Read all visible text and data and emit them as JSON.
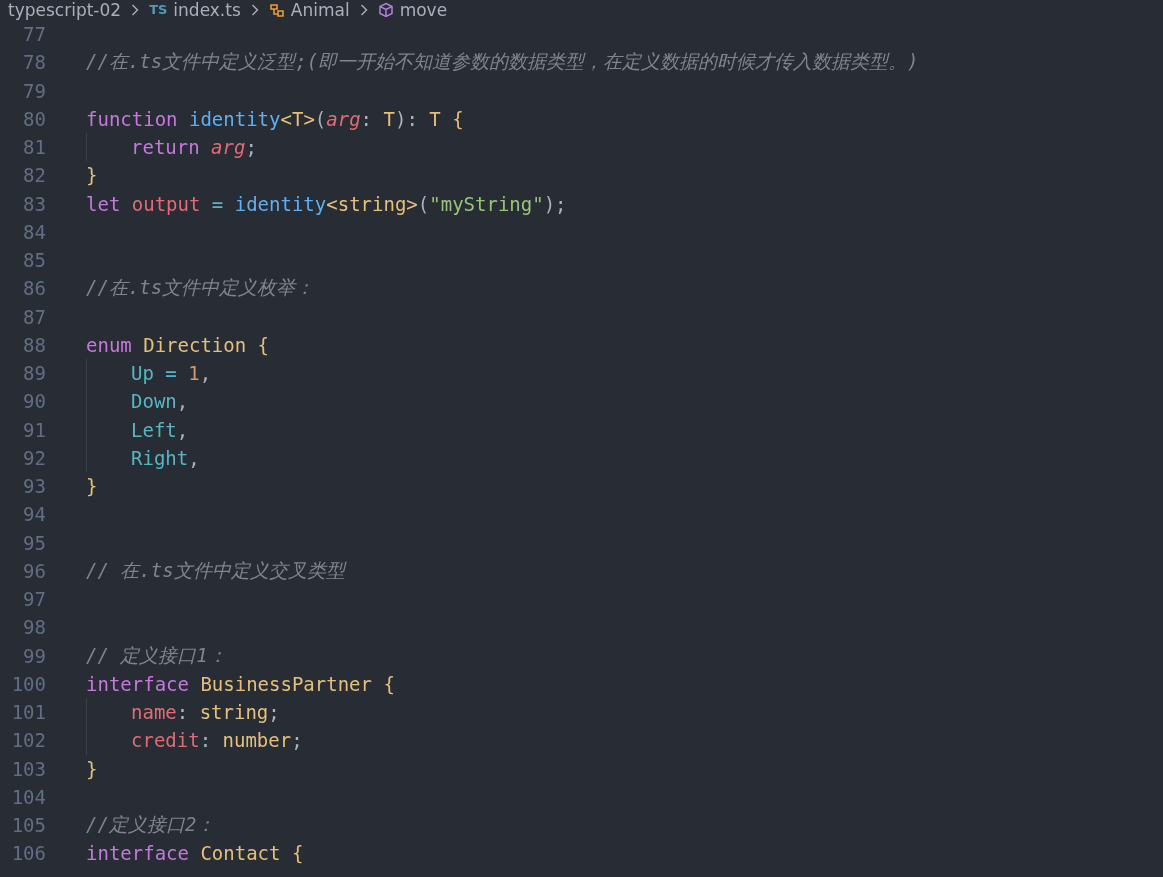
{
  "breadcrumb": [
    {
      "kind": "folder",
      "label": "typescript-02"
    },
    {
      "kind": "file",
      "badge": "TS",
      "label": "index.ts"
    },
    {
      "kind": "class",
      "label": "Animal"
    },
    {
      "kind": "method",
      "label": "move"
    }
  ],
  "lines": [
    {
      "number": "77"
    },
    {
      "number": "78",
      "tokens": [
        {
          "kind": "comment",
          "text": "//在.ts文件中定义泛型;(即一开始不知道参数的数据类型，在定义数据的时候才传入数据类型。)"
        }
      ]
    },
    {
      "number": "79"
    },
    {
      "number": "80",
      "tokens": [
        {
          "kind": "keyword",
          "text": "function "
        },
        {
          "kind": "function",
          "text": "identity"
        },
        {
          "kind": "bracket",
          "text": "<"
        },
        {
          "kind": "type",
          "text": "T"
        },
        {
          "kind": "bracket",
          "text": ">"
        },
        {
          "kind": "plain",
          "text": "("
        },
        {
          "kind": "param",
          "text": "arg"
        },
        {
          "kind": "plain",
          "text": ": "
        },
        {
          "kind": "type",
          "text": "T"
        },
        {
          "kind": "plain",
          "text": "): "
        },
        {
          "kind": "type",
          "text": "T "
        },
        {
          "kind": "bracket",
          "text": "{"
        }
      ]
    },
    {
      "number": "81",
      "indented": true,
      "tokens": [
        {
          "kind": "keyword",
          "text": "return "
        },
        {
          "kind": "param",
          "text": "arg"
        },
        {
          "kind": "plain",
          "text": ";"
        }
      ]
    },
    {
      "number": "82",
      "tokens": [
        {
          "kind": "bracket",
          "text": "}"
        }
      ]
    },
    {
      "number": "83",
      "tokens": [
        {
          "kind": "keyword",
          "text": "let "
        },
        {
          "kind": "variable",
          "text": "output "
        },
        {
          "kind": "operator",
          "text": "= "
        },
        {
          "kind": "function",
          "text": "identity"
        },
        {
          "kind": "bracket",
          "text": "<"
        },
        {
          "kind": "type",
          "text": "string"
        },
        {
          "kind": "bracket",
          "text": ">"
        },
        {
          "kind": "plain",
          "text": "("
        },
        {
          "kind": "string",
          "text": "\"myString\""
        },
        {
          "kind": "plain",
          "text": ");"
        }
      ]
    },
    {
      "number": "84"
    },
    {
      "number": "85"
    },
    {
      "number": "86",
      "tokens": [
        {
          "kind": "comment",
          "text": "//在.ts文件中定义枚举："
        }
      ]
    },
    {
      "number": "87"
    },
    {
      "number": "88",
      "tokens": [
        {
          "kind": "keyword",
          "text": "enum "
        },
        {
          "kind": "type",
          "text": "Direction "
        },
        {
          "kind": "bracket",
          "text": "{"
        }
      ]
    },
    {
      "number": "89",
      "indented": true,
      "tokens": [
        {
          "kind": "member",
          "text": "Up "
        },
        {
          "kind": "operator",
          "text": "= "
        },
        {
          "kind": "number",
          "text": "1"
        },
        {
          "kind": "plain",
          "text": ","
        }
      ]
    },
    {
      "number": "90",
      "indented": true,
      "tokens": [
        {
          "kind": "member",
          "text": "Down"
        },
        {
          "kind": "plain",
          "text": ","
        }
      ]
    },
    {
      "number": "91",
      "indented": true,
      "tokens": [
        {
          "kind": "member",
          "text": "Left"
        },
        {
          "kind": "plain",
          "text": ","
        }
      ]
    },
    {
      "number": "92",
      "indented": true,
      "tokens": [
        {
          "kind": "member",
          "text": "Right"
        },
        {
          "kind": "plain",
          "text": ","
        }
      ]
    },
    {
      "number": "93",
      "tokens": [
        {
          "kind": "bracket",
          "text": "}"
        }
      ]
    },
    {
      "number": "94"
    },
    {
      "number": "95"
    },
    {
      "number": "96",
      "tokens": [
        {
          "kind": "comment",
          "text": "// 在.ts文件中定义交叉类型"
        }
      ]
    },
    {
      "number": "97"
    },
    {
      "number": "98"
    },
    {
      "number": "99",
      "tokens": [
        {
          "kind": "comment",
          "text": "// 定义接口1："
        }
      ]
    },
    {
      "number": "100",
      "tokens": [
        {
          "kind": "keyword",
          "text": "interface "
        },
        {
          "kind": "type",
          "text": "BusinessPartner "
        },
        {
          "kind": "bracket",
          "text": "{"
        }
      ]
    },
    {
      "number": "101",
      "indented": true,
      "tokens": [
        {
          "kind": "property",
          "text": "name"
        },
        {
          "kind": "plain",
          "text": ": "
        },
        {
          "kind": "type",
          "text": "string"
        },
        {
          "kind": "plain",
          "text": ";"
        }
      ]
    },
    {
      "number": "102",
      "indented": true,
      "tokens": [
        {
          "kind": "property",
          "text": "credit"
        },
        {
          "kind": "plain",
          "text": ": "
        },
        {
          "kind": "type",
          "text": "number"
        },
        {
          "kind": "plain",
          "text": ";"
        }
      ]
    },
    {
      "number": "103",
      "tokens": [
        {
          "kind": "bracket",
          "text": "}"
        }
      ]
    },
    {
      "number": "104"
    },
    {
      "number": "105",
      "tokens": [
        {
          "kind": "comment",
          "text": "//定义接口2："
        }
      ]
    },
    {
      "number": "106",
      "tokens": [
        {
          "kind": "keyword",
          "text": "interface "
        },
        {
          "kind": "type",
          "text": "Contact "
        },
        {
          "kind": "bracket",
          "text": "{"
        }
      ]
    }
  ]
}
